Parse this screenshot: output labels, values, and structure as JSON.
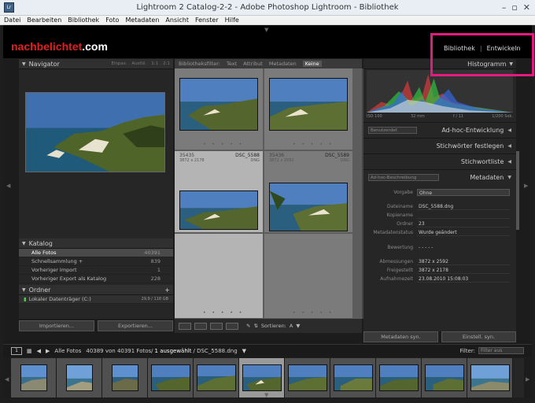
{
  "window": {
    "title": "Lightroom 2 Catalog-2-2 - Adobe Photoshop Lightroom - Bibliothek",
    "app_icon": "Lr"
  },
  "menu": [
    "Datei",
    "Bearbeiten",
    "Bibliothek",
    "Foto",
    "Metadaten",
    "Ansicht",
    "Fenster",
    "Hilfe"
  ],
  "brand": {
    "prefix": "nachbelichtet",
    "suffix": ".com"
  },
  "modules": {
    "library": "Bibliothek",
    "separator": "|",
    "develop": "Entwickeln"
  },
  "navigator": {
    "title": "Navigator",
    "zoom": [
      "Einpas.",
      "Ausfül.",
      "1:1",
      "2:1"
    ]
  },
  "catalog": {
    "title": "Katalog",
    "items": [
      {
        "label": "Alle Fotos",
        "count": "40391"
      },
      {
        "label": "Schnellsammlung +",
        "count": "839"
      },
      {
        "label": "Vorheriger Import",
        "count": "1"
      },
      {
        "label": "Vorheriger Export als Katalog",
        "count": "228"
      }
    ]
  },
  "folders": {
    "title": "Ordner",
    "add": "+",
    "drive": "Lokaler Datenträger (C:)",
    "drive_size": "29,9 / 118 GB"
  },
  "left_buttons": {
    "import": "Importieren...",
    "export": "Exportieren..."
  },
  "library_filter": {
    "label": "Bibliotheksfilter:",
    "tabs": [
      "Text",
      "Attribut",
      "Metadaten",
      "Keine"
    ],
    "active": "Keine"
  },
  "grid": {
    "cells": [
      {
        "index": "35435",
        "name": "DSC_5588",
        "dims": "3872 x 2178",
        "type": "DNG"
      },
      {
        "index": "35436",
        "name": "DSC_5589",
        "dims": "3872 x 2592",
        "type": "DNG"
      }
    ]
  },
  "toolbar": {
    "sort_label": "Sortieren:",
    "sort_value": "A"
  },
  "histogram": {
    "title": "Histogramm",
    "info": [
      "ISO 100",
      "32 mm",
      "f / 11",
      "1/200 Sek."
    ]
  },
  "quick_develop": {
    "preset": "Benutzerdef.",
    "title": "Ad-hoc-Entwicklung"
  },
  "keywording": {
    "title": "Stichwörter festlegen"
  },
  "keyword_list": {
    "title": "Stichwortliste"
  },
  "metadata": {
    "preset": "Ad-hoc-Beschreibung",
    "title": "Metadaten",
    "vorgabe_label": "Vorgabe",
    "vorgabe_value": "Ohne",
    "fields": [
      {
        "k": "Dateiname",
        "v": "DSC_5588.dng"
      },
      {
        "k": "Kopiename",
        "v": ""
      },
      {
        "k": "Ordner",
        "v": "23"
      },
      {
        "k": "Metadatenstatus",
        "v": "Wurde geändert"
      },
      {
        "k": "Bewertung",
        "v": "- - - - -"
      },
      {
        "k": "Abmessungen",
        "v": "3872 x 2592"
      },
      {
        "k": "Freigestellt",
        "v": "3872 x 2178"
      },
      {
        "k": "Aufnahmezeit",
        "v": "23.08.2010 15:08:03"
      }
    ]
  },
  "right_buttons": {
    "sync_meta": "Metadaten syn.",
    "sync_settings": "Einstell. syn."
  },
  "filmstrip_bar": {
    "page": "1",
    "source": "Alle Fotos",
    "count": "40389 von 40391 Fotos/",
    "selected": "1 ausgewählt",
    "file": "/ DSC_5588.dng",
    "filter_label": "Filter:",
    "filter_value": "Filter aus"
  },
  "colors": {
    "highlight": "#e6197f",
    "brand_red": "#e02020"
  }
}
